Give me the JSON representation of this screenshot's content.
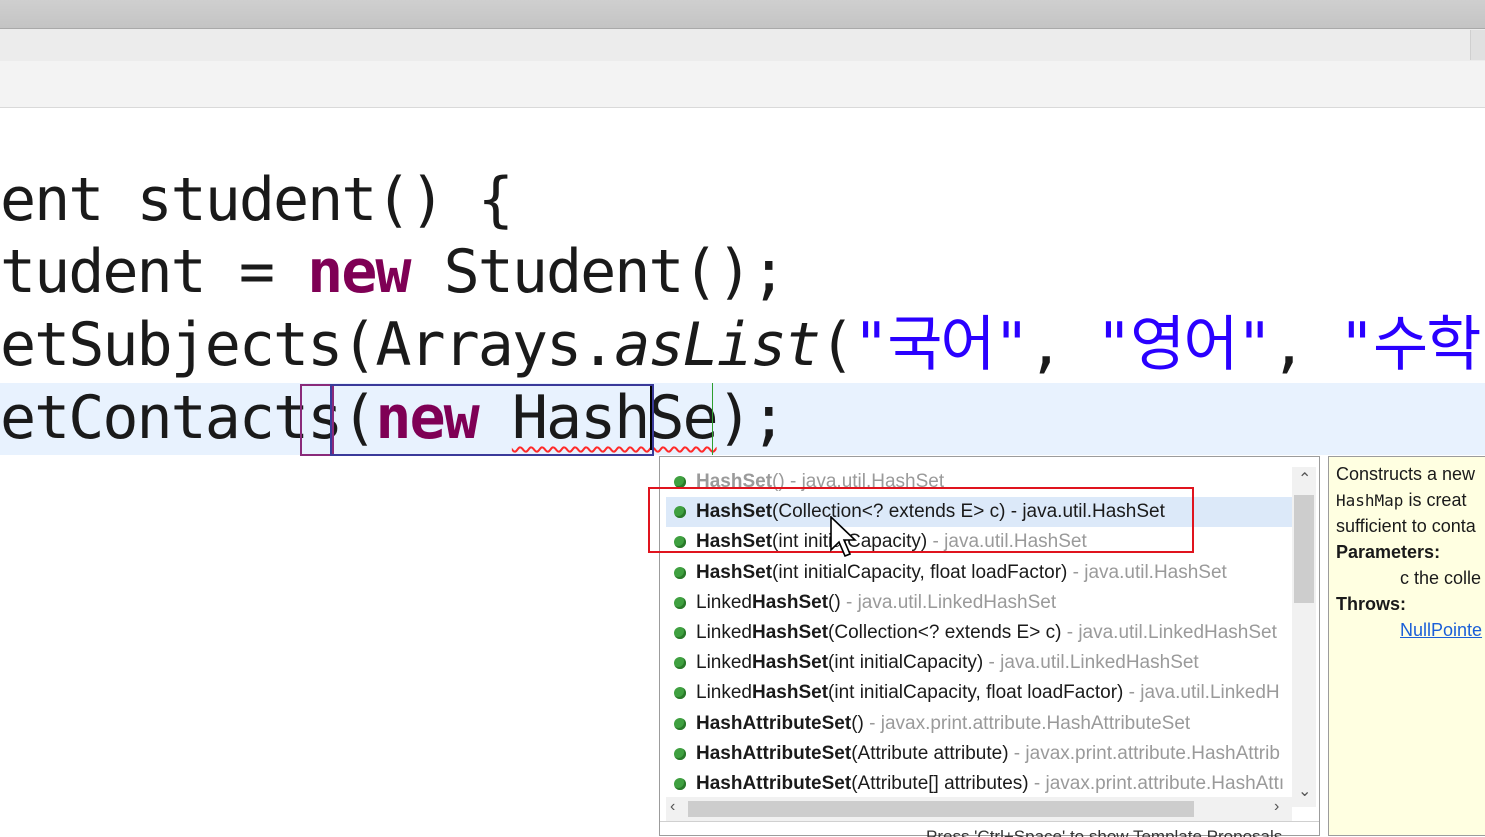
{
  "editor": {
    "line1": "ent student() {",
    "line2_pre": "tudent = ",
    "line2_kw": "new",
    "line2_post": " Student();",
    "line3_pre": "etSubjects(Arrays.",
    "line3_it": "asList",
    "line3_post": "(",
    "line3_s1": "\"국어\"",
    "line3_c1": ", ",
    "line3_s2": "\"영어\"",
    "line3_c2": ", ",
    "line3_s3": "\"수학\"",
    "line3_end": ")",
    "line4_pre": "etContacts(",
    "line4_kw": "new",
    "line4_space": " ",
    "line4_typed": "HashSe",
    "line4_post": ");"
  },
  "autocomplete": {
    "items": [
      {
        "pre": "",
        "bold": "HashSet",
        "args": "()",
        "qual": " - java.util.HashSet",
        "faded": true
      },
      {
        "pre": "",
        "bold": "HashSet",
        "args": "(Collection<? extends E> c)",
        "qual": " - java.util.HashSet",
        "selected": true
      },
      {
        "pre": "",
        "bold": "HashSet",
        "args": "(int initialCapacity)",
        "qual": " - java.util.HashSet"
      },
      {
        "pre": "",
        "bold": "HashSet",
        "args": "(int initialCapacity, float loadFactor)",
        "qual": " - java.util.HashSet"
      },
      {
        "pre": "Linked",
        "bold": "HashSet",
        "args": "()",
        "qual": " - java.util.LinkedHashSet"
      },
      {
        "pre": "Linked",
        "bold": "HashSet",
        "args": "(Collection<? extends E> c)",
        "qual": " - java.util.LinkedHashSet"
      },
      {
        "pre": "Linked",
        "bold": "HashSet",
        "args": "(int initialCapacity)",
        "qual": " - java.util.LinkedHashSet"
      },
      {
        "pre": "Linked",
        "bold": "HashSet",
        "args": "(int initialCapacity, float loadFactor)",
        "qual": " - java.util.LinkedH"
      },
      {
        "pre": "",
        "bold": "HashAttributeSet",
        "args": "()",
        "qual": " - javax.print.attribute.HashAttributeSet"
      },
      {
        "pre": "",
        "bold": "HashAttributeSet",
        "args": "(Attribute attribute)",
        "qual": " - javax.print.attribute.HashAttrib"
      },
      {
        "pre": "",
        "bold": "HashAttributeSet",
        "args": "(Attribute[] attributes)",
        "qual": " - javax.print.attribute.HashAttı"
      }
    ],
    "status": "Press 'Ctrl+Space' to show Template Proposals",
    "icon": "public-method-icon",
    "item_color": "#3fa040"
  },
  "doc": {
    "line1": "Constructs a new",
    "line2_code": "HashMap",
    "line2_rest": " is creat",
    "line3": "sufficient to conta",
    "params_label": "Parameters:",
    "param_name": "c",
    "param_desc": " the colle",
    "throws_label": "Throws:",
    "throws_link": "NullPointe"
  },
  "highlight": {
    "box_color": "#e0141e"
  }
}
